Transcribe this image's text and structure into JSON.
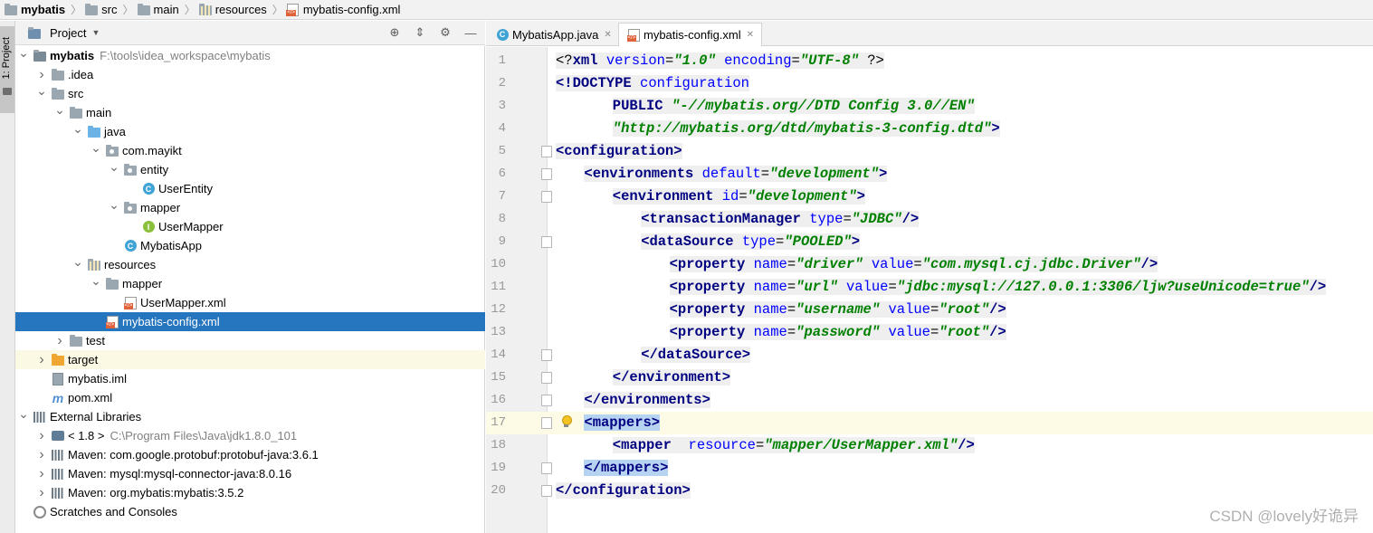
{
  "breadcrumb": [
    {
      "label": "mybatis",
      "icon": "project-folder-icon",
      "bold": true
    },
    {
      "label": "src",
      "icon": "folder-icon"
    },
    {
      "label": "main",
      "icon": "folder-icon"
    },
    {
      "label": "resources",
      "icon": "resources-folder-icon"
    },
    {
      "label": "mybatis-config.xml",
      "icon": "xml-file-icon"
    }
  ],
  "side_strip": {
    "project_tab_label": "1: Project"
  },
  "project_panel": {
    "title": "Project",
    "tools": [
      "locate-icon",
      "collapse-icon",
      "gear-icon",
      "hide-icon"
    ]
  },
  "tree": [
    {
      "label": "mybatis",
      "hint": "F:\\tools\\idea_workspace\\mybatis",
      "depth": 0,
      "arrow": "open",
      "icon": "module",
      "bold": true
    },
    {
      "label": ".idea",
      "depth": 1,
      "arrow": "closed",
      "icon": "folder"
    },
    {
      "label": "src",
      "depth": 1,
      "arrow": "open",
      "icon": "folder"
    },
    {
      "label": "main",
      "depth": 2,
      "arrow": "open",
      "icon": "folder"
    },
    {
      "label": "java",
      "depth": 3,
      "arrow": "open",
      "icon": "source-folder"
    },
    {
      "label": "com.mayikt",
      "depth": 4,
      "arrow": "open",
      "icon": "package"
    },
    {
      "label": "entity",
      "depth": 5,
      "arrow": "open",
      "icon": "package"
    },
    {
      "label": "UserEntity",
      "depth": 6,
      "arrow": "none",
      "icon": "class"
    },
    {
      "label": "mapper",
      "depth": 5,
      "arrow": "open",
      "icon": "package"
    },
    {
      "label": "UserMapper",
      "depth": 6,
      "arrow": "none",
      "icon": "interface"
    },
    {
      "label": "MybatisApp",
      "depth": 5,
      "arrow": "none",
      "icon": "class"
    },
    {
      "label": "resources",
      "depth": 3,
      "arrow": "open",
      "icon": "resources-folder"
    },
    {
      "label": "mapper",
      "depth": 4,
      "arrow": "open",
      "icon": "folder"
    },
    {
      "label": "UserMapper.xml",
      "depth": 5,
      "arrow": "none",
      "icon": "xml"
    },
    {
      "label": "mybatis-config.xml",
      "depth": 4,
      "arrow": "none",
      "icon": "xml",
      "selected": true
    },
    {
      "label": "test",
      "depth": 2,
      "arrow": "closed",
      "icon": "folder"
    },
    {
      "label": "target",
      "depth": 1,
      "arrow": "closed",
      "icon": "excluded-folder",
      "excluded": true
    },
    {
      "label": "mybatis.iml",
      "depth": 1,
      "arrow": "none",
      "icon": "iml"
    },
    {
      "label": "pom.xml",
      "depth": 1,
      "arrow": "none",
      "icon": "maven"
    },
    {
      "label": "External Libraries",
      "depth": 0,
      "arrow": "open",
      "icon": "libraries"
    },
    {
      "label": "< 1.8 >",
      "hint": "C:\\Program Files\\Java\\jdk1.8.0_101",
      "depth": 1,
      "arrow": "closed",
      "icon": "jdk"
    },
    {
      "label": "Maven: com.google.protobuf:protobuf-java:3.6.1",
      "depth": 1,
      "arrow": "closed",
      "icon": "library"
    },
    {
      "label": "Maven: mysql:mysql-connector-java:8.0.16",
      "depth": 1,
      "arrow": "closed",
      "icon": "library"
    },
    {
      "label": "Maven: org.mybatis:mybatis:3.5.2",
      "depth": 1,
      "arrow": "closed",
      "icon": "library"
    },
    {
      "label": "Scratches and Consoles",
      "depth": 0,
      "arrow": "none",
      "icon": "scratches"
    }
  ],
  "editor": {
    "tabs": [
      {
        "label": "MybatisApp.java",
        "icon": "class-file-icon",
        "active": false
      },
      {
        "label": "mybatis-config.xml",
        "icon": "xml-file-icon",
        "active": true
      }
    ],
    "caret_line": 17,
    "lines": [
      {
        "n": "1",
        "indent": 0,
        "fold": false,
        "tokens": [
          [
            "p",
            "<?"
          ],
          [
            "k",
            "xml "
          ],
          [
            "a",
            "version"
          ],
          [
            "p",
            "="
          ],
          [
            "v",
            "\"1.0\""
          ],
          [
            "p",
            " "
          ],
          [
            "a",
            "encoding"
          ],
          [
            "p",
            "="
          ],
          [
            "v",
            "\"UTF-8\""
          ],
          [
            "p",
            " ?>"
          ]
        ]
      },
      {
        "n": "2",
        "indent": 0,
        "fold": false,
        "tokens": [
          [
            "k",
            "<!DOCTYPE "
          ],
          [
            "a",
            "configuration"
          ]
        ]
      },
      {
        "n": "3",
        "indent": 8,
        "fold": false,
        "tokens": [
          [
            "k",
            "PUBLIC "
          ],
          [
            "v",
            "\"-//mybatis.org//DTD Config 3.0//EN\""
          ]
        ]
      },
      {
        "n": "4",
        "indent": 8,
        "fold": false,
        "tokens": [
          [
            "v",
            "\"http://mybatis.org/dtd/mybatis-3-config.dtd\""
          ],
          [
            "k",
            ">"
          ]
        ]
      },
      {
        "n": "5",
        "indent": 0,
        "fold": true,
        "tokens": [
          [
            "k",
            "<configuration>"
          ]
        ]
      },
      {
        "n": "6",
        "indent": 4,
        "fold": true,
        "tokens": [
          [
            "k",
            "<environments "
          ],
          [
            "a",
            "default"
          ],
          [
            "p",
            "="
          ],
          [
            "v",
            "\"development\""
          ],
          [
            "k",
            ">"
          ]
        ]
      },
      {
        "n": "7",
        "indent": 8,
        "fold": true,
        "tokens": [
          [
            "k",
            "<environment "
          ],
          [
            "a",
            "id"
          ],
          [
            "p",
            "="
          ],
          [
            "v",
            "\"development\""
          ],
          [
            "k",
            ">"
          ]
        ]
      },
      {
        "n": "8",
        "indent": 12,
        "fold": false,
        "tokens": [
          [
            "k",
            "<transactionManager "
          ],
          [
            "a",
            "type"
          ],
          [
            "p",
            "="
          ],
          [
            "v",
            "\"JDBC\""
          ],
          [
            "k",
            "/>"
          ]
        ]
      },
      {
        "n": "9",
        "indent": 12,
        "fold": true,
        "tokens": [
          [
            "k",
            "<dataSource "
          ],
          [
            "a",
            "type"
          ],
          [
            "p",
            "="
          ],
          [
            "v",
            "\"POOLED\""
          ],
          [
            "k",
            ">"
          ]
        ]
      },
      {
        "n": "10",
        "indent": 16,
        "fold": false,
        "tokens": [
          [
            "k",
            "<property "
          ],
          [
            "a",
            "name"
          ],
          [
            "p",
            "="
          ],
          [
            "v",
            "\"driver\""
          ],
          [
            "p",
            " "
          ],
          [
            "a",
            "value"
          ],
          [
            "p",
            "="
          ],
          [
            "v",
            "\"com.mysql.cj.jdbc.Driver\""
          ],
          [
            "k",
            "/>"
          ]
        ]
      },
      {
        "n": "11",
        "indent": 16,
        "fold": false,
        "tokens": [
          [
            "k",
            "<property "
          ],
          [
            "a",
            "name"
          ],
          [
            "p",
            "="
          ],
          [
            "v",
            "\"url\""
          ],
          [
            "p",
            " "
          ],
          [
            "a",
            "value"
          ],
          [
            "p",
            "="
          ],
          [
            "v",
            "\"jdbc:mysql://127.0.0.1:3306/ljw?useUnicode=true\""
          ],
          [
            "k",
            "/>"
          ]
        ]
      },
      {
        "n": "12",
        "indent": 16,
        "fold": false,
        "tokens": [
          [
            "k",
            "<property "
          ],
          [
            "a",
            "name"
          ],
          [
            "p",
            "="
          ],
          [
            "v",
            "\"username\""
          ],
          [
            "p",
            " "
          ],
          [
            "a",
            "value"
          ],
          [
            "p",
            "="
          ],
          [
            "v",
            "\"root\""
          ],
          [
            "k",
            "/>"
          ]
        ]
      },
      {
        "n": "13",
        "indent": 16,
        "fold": false,
        "tokens": [
          [
            "k",
            "<property "
          ],
          [
            "a",
            "name"
          ],
          [
            "p",
            "="
          ],
          [
            "v",
            "\"password\""
          ],
          [
            "p",
            " "
          ],
          [
            "a",
            "value"
          ],
          [
            "p",
            "="
          ],
          [
            "v",
            "\"root\""
          ],
          [
            "k",
            "/>"
          ]
        ]
      },
      {
        "n": "14",
        "indent": 12,
        "fold": true,
        "tokens": [
          [
            "k",
            "</dataSource>"
          ]
        ]
      },
      {
        "n": "15",
        "indent": 8,
        "fold": true,
        "tokens": [
          [
            "k",
            "</environment>"
          ]
        ]
      },
      {
        "n": "16",
        "indent": 4,
        "fold": true,
        "tokens": [
          [
            "k",
            "</environments>"
          ]
        ]
      },
      {
        "n": "17",
        "indent": 4,
        "fold": true,
        "highlight": true,
        "tokens": [
          [
            "k",
            "<mappers>"
          ]
        ]
      },
      {
        "n": "18",
        "indent": 8,
        "fold": false,
        "tokens": [
          [
            "k",
            "<mapper  "
          ],
          [
            "a",
            "resource"
          ],
          [
            "p",
            "="
          ],
          [
            "v",
            "\"mapper/UserMapper.xml\""
          ],
          [
            "k",
            "/>"
          ]
        ]
      },
      {
        "n": "19",
        "indent": 4,
        "fold": true,
        "highlight": true,
        "tokens": [
          [
            "k",
            "</mappers>"
          ]
        ]
      },
      {
        "n": "20",
        "indent": 0,
        "fold": true,
        "tokens": [
          [
            "k",
            "</configuration>"
          ]
        ]
      }
    ]
  },
  "watermark": "CSDN @lovely好诡异"
}
